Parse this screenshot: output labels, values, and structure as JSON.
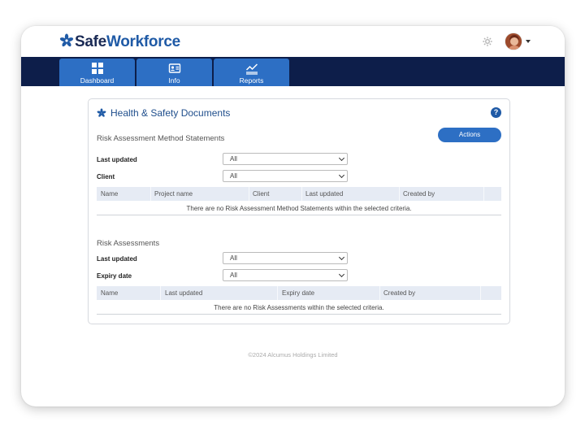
{
  "app": {
    "logo_safe": "Safe",
    "logo_workforce": "Workforce"
  },
  "header": {
    "settings_icon": "gear-icon",
    "avatar_icon": "user-avatar"
  },
  "nav": {
    "tabs": [
      {
        "label": "Dashboard",
        "icon": "grid-icon"
      },
      {
        "label": "Info",
        "icon": "id-card-icon"
      },
      {
        "label": "Reports",
        "icon": "chart-icon"
      }
    ]
  },
  "card": {
    "title": "Health & Safety Documents",
    "help": "?"
  },
  "rams": {
    "title": "Risk Assessment Method Statements",
    "actions_label": "Actions",
    "filters": [
      {
        "label": "Last updated",
        "value": "All"
      },
      {
        "label": "Client",
        "value": "All"
      }
    ],
    "columns": [
      "Name",
      "Project name",
      "Client",
      "Last updated",
      "Created by"
    ],
    "empty_message": "There are no Risk Assessment Method Statements within the selected criteria."
  },
  "ra": {
    "title": "Risk Assessments",
    "filters": [
      {
        "label": "Last updated",
        "value": "All"
      },
      {
        "label": "Expiry date",
        "value": "All"
      }
    ],
    "columns": [
      "Name",
      "Last updated",
      "Expiry date",
      "Created by"
    ],
    "empty_message": "There are no Risk Assessments within the selected criteria."
  },
  "footer": {
    "copyright": "©2024 Alcumus Holdings Limited"
  },
  "colors": {
    "navbar": "#0d1e4a",
    "tab": "#2d6fc4",
    "brand_dark": "#1a2a55",
    "brand_blue": "#1f5aa6",
    "table_header": "#e6ebf4"
  }
}
